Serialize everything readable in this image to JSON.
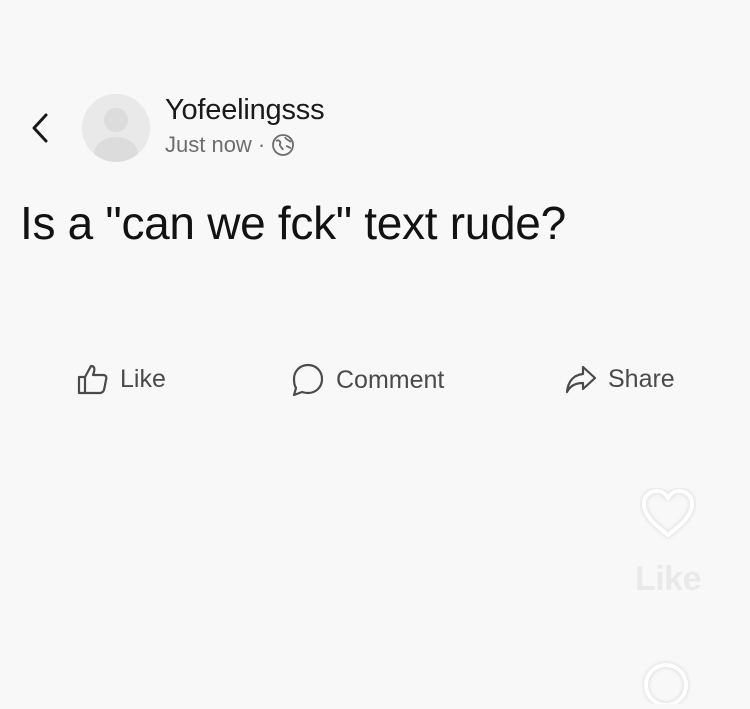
{
  "header": {
    "back_icon": "chevron-left-icon",
    "author_name": "Yofeelingsss",
    "timestamp": "Just now",
    "separator": "·",
    "privacy_icon": "globe-icon"
  },
  "post": {
    "text": "Is a \"can we fck\" text rude?"
  },
  "actions": {
    "like_label": "Like",
    "comment_label": "Comment",
    "share_label": "Share"
  },
  "side_overlay": {
    "like_icon": "heart-icon",
    "like_label": "Like",
    "comment_icon": "search-icon"
  },
  "colors": {
    "background": "#f9f8f9",
    "text": "#141414",
    "muted": "#6d6d6d",
    "action": "#4a4a4a",
    "overlay": "#e9e9e9"
  }
}
